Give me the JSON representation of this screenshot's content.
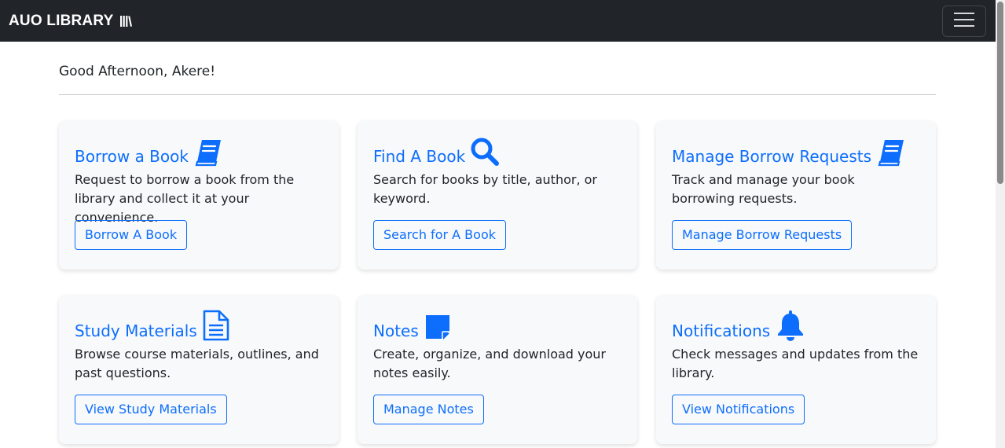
{
  "navbar": {
    "brand": "AUO LIBRARY",
    "brand_icon": "books-icon",
    "toggle_icon": "hamburger-menu-icon"
  },
  "greeting": "Good Afternoon, Akere!",
  "cards": [
    {
      "title": "Borrow a Book",
      "icon": "book-icon",
      "text": "Request to borrow a book from the library and collect it at your convenience.",
      "button": "Borrow A Book"
    },
    {
      "title": "Find A Book",
      "icon": "search-icon",
      "text": "Search for books by title, author, or keyword.",
      "button": "Search for A Book"
    },
    {
      "title": "Manage Borrow Requests",
      "icon": "book-icon",
      "text": "Track and manage your book borrowing requests.",
      "button": "Manage Borrow Requests"
    },
    {
      "title": "Study Materials",
      "icon": "document-icon",
      "text": "Browse course materials, outlines, and past questions.",
      "button": "View Study Materials"
    },
    {
      "title": "Notes",
      "icon": "sticky-note-icon",
      "text": "Create, organize, and download your notes easily.",
      "button": "Manage Notes"
    },
    {
      "title": "Notifications",
      "icon": "bell-icon",
      "text": "Check messages and updates from the library.",
      "button": "View Notifications"
    }
  ],
  "colors": {
    "navbar_bg": "#212529",
    "accent": "#0d6efd",
    "card_bg": "#f8f9fa"
  }
}
